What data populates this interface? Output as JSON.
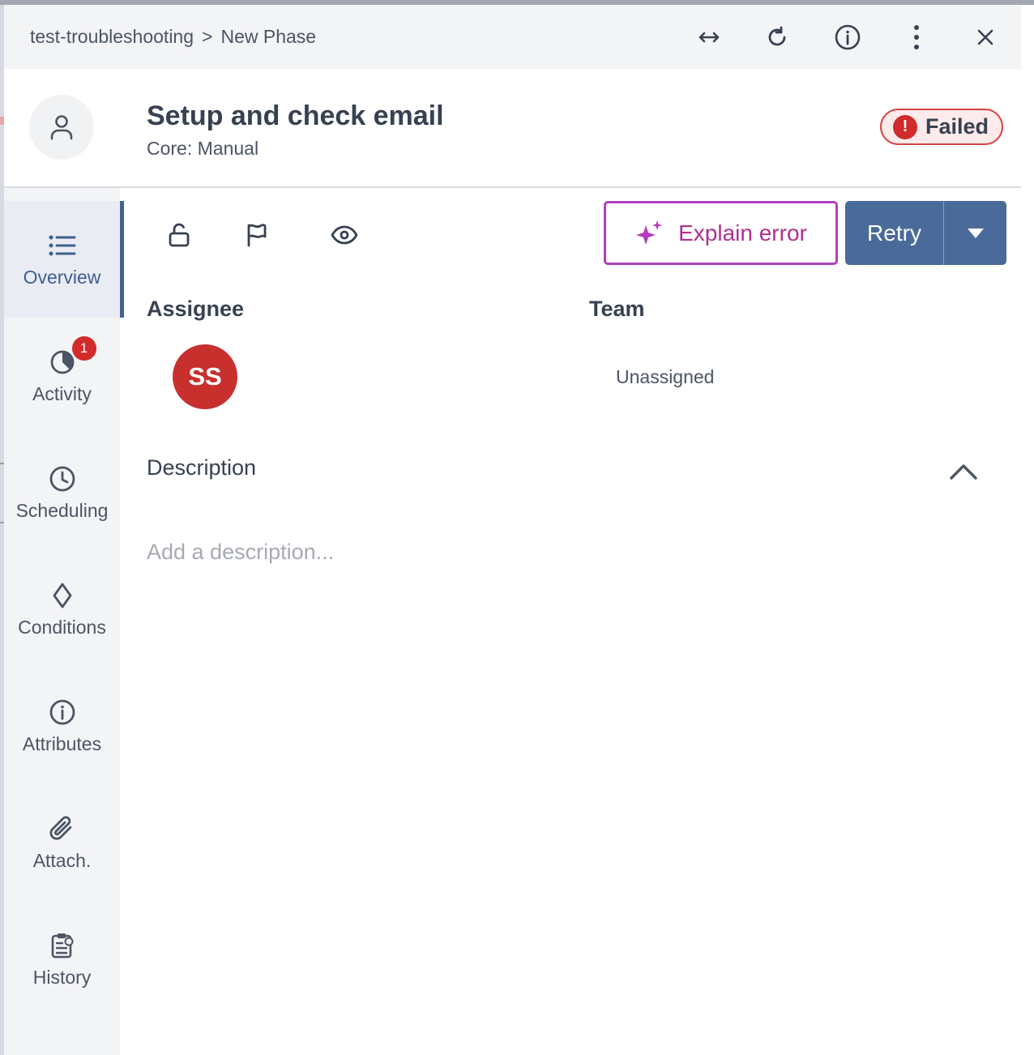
{
  "breadcrumb": {
    "parent": "test-troubleshooting",
    "separator": ">",
    "current": "New Phase"
  },
  "topbar_icons": [
    "expand-horizontal-icon",
    "refresh-icon",
    "info-icon",
    "more-vertical-icon",
    "close-icon"
  ],
  "task": {
    "title": "Setup and check email",
    "subtitle": "Core: Manual",
    "status": "Failed",
    "status_icon": "!"
  },
  "sidebar": {
    "items": [
      {
        "label": "Overview",
        "icon": "list-icon",
        "active": true
      },
      {
        "label": "Activity",
        "icon": "activity-icon",
        "badge": "1"
      },
      {
        "label": "Scheduling",
        "icon": "clock-icon"
      },
      {
        "label": "Conditions",
        "icon": "diamond-icon"
      },
      {
        "label": "Attributes",
        "icon": "info-icon"
      },
      {
        "label": "Attach.",
        "icon": "paperclip-icon"
      },
      {
        "label": "History",
        "icon": "history-icon"
      }
    ]
  },
  "toolbar": {
    "icons": [
      "unlock-icon",
      "flag-icon",
      "eye-icon"
    ],
    "explain_label": "Explain error",
    "retry_label": "Retry"
  },
  "fields": {
    "assignee_label": "Assignee",
    "assignee_initials": "SS",
    "team_label": "Team",
    "team_value": "Unassigned"
  },
  "description": {
    "heading": "Description",
    "placeholder": "Add a description..."
  },
  "colors": {
    "primary": "#4a6a99",
    "failed": "#d12b2b",
    "avatar": "#c8302e",
    "ai_accent": "#b03fbf"
  }
}
